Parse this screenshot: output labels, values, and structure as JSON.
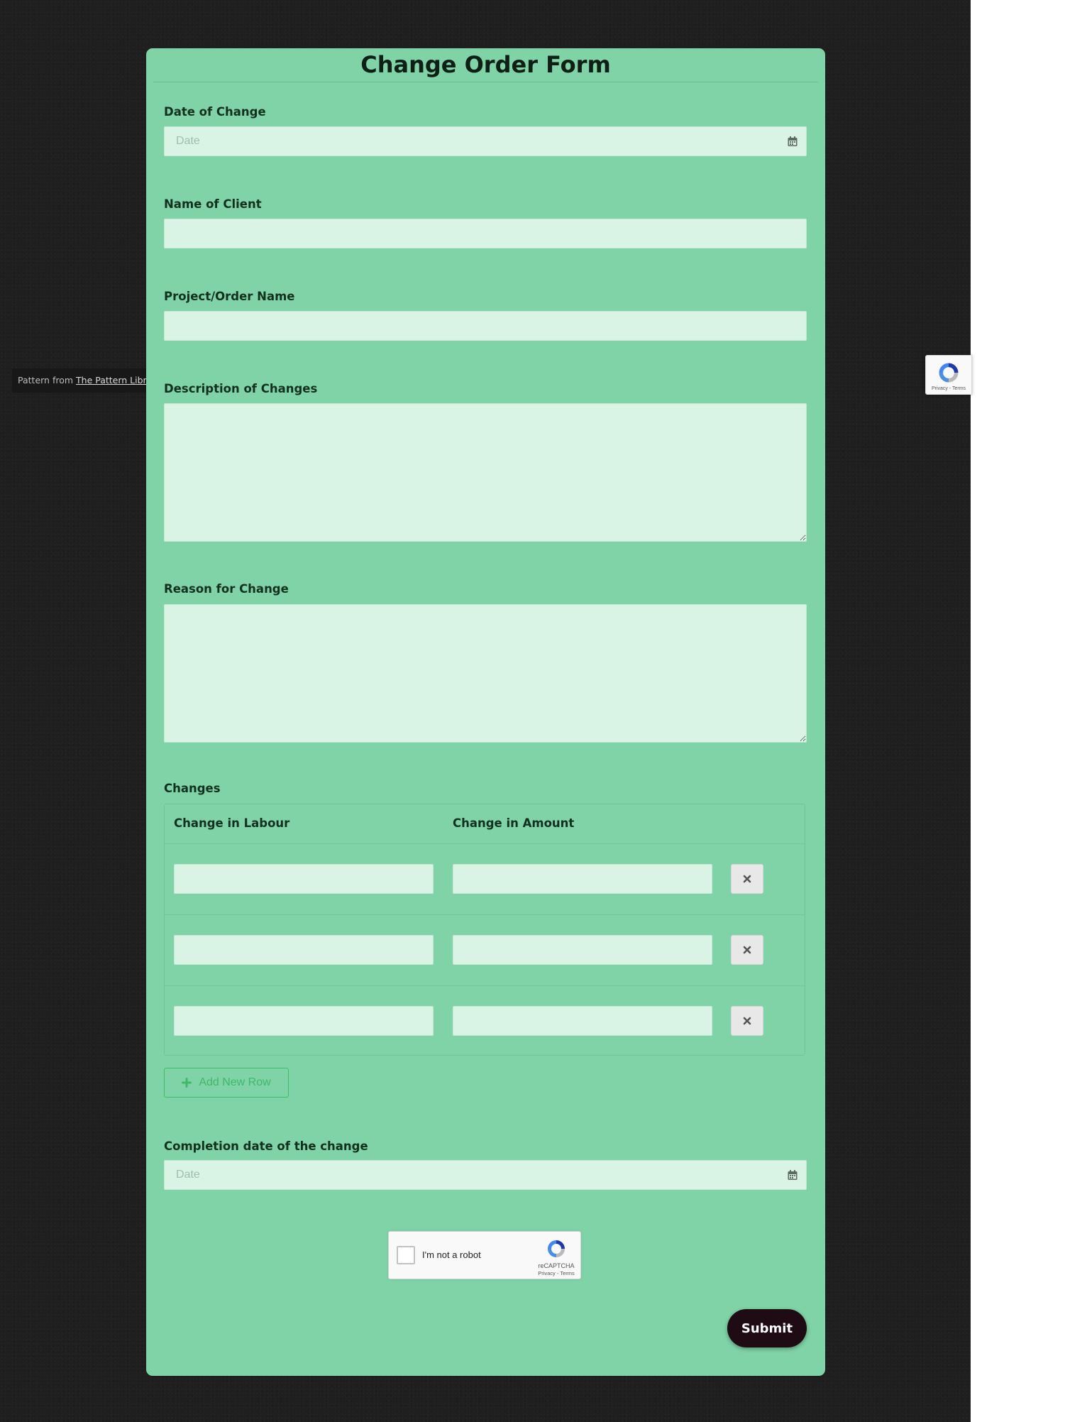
{
  "form": {
    "title": "Change Order Form",
    "fields": {
      "date_of_change": {
        "label": "Date of Change",
        "placeholder": "Date",
        "value": ""
      },
      "name_of_client": {
        "label": "Name of Client",
        "value": ""
      },
      "project_order_name": {
        "label": "Project/Order Name",
        "value": ""
      },
      "description_of_changes": {
        "label": "Description of Changes",
        "value": ""
      },
      "reason_for_change": {
        "label": "Reason for Change",
        "value": ""
      },
      "completion_date": {
        "label": "Completion date of the change",
        "placeholder": "Date",
        "value": ""
      }
    },
    "changes_table": {
      "label": "Changes",
      "columns": [
        "Change in Labour",
        "Change in Amount"
      ],
      "rows": [
        {
          "labour": "",
          "amount": ""
        },
        {
          "labour": "",
          "amount": ""
        },
        {
          "labour": "",
          "amount": ""
        }
      ],
      "add_row_label": "Add New Row"
    },
    "recaptcha": {
      "label": "I'm not a robot",
      "brand": "reCAPTCHA",
      "terms": "Privacy - Terms"
    },
    "submit_label": "Submit"
  },
  "pattern_credit": {
    "prefix": "Pattern from ",
    "link_text": "The Pattern Library"
  },
  "recaptcha_badge": {
    "terms": "Privacy - Terms"
  },
  "icons": {
    "date_icon": "calendar-icon",
    "remove_icon": "times-icon",
    "add_icon": "plus-icon",
    "recaptcha_logo": "recaptcha-logo-icon"
  },
  "colors": {
    "background": "#1f1f1f",
    "card": "#7fd3a6",
    "input_fill": "#d9f3e5",
    "add_row_accent": "#3fb86a",
    "submit_fill": "#1f0b14"
  }
}
